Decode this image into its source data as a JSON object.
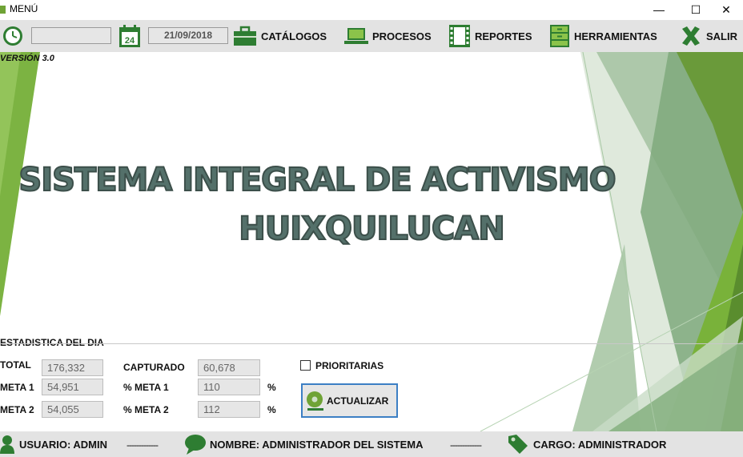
{
  "window": {
    "title": "MENÚ",
    "minimize": "—",
    "maximize": "☐",
    "close": "✕"
  },
  "toolbar": {
    "clock_value": "",
    "date_value": "21/09/2018",
    "calendar_day": "24",
    "catalogos": "CATÁLOGOS",
    "procesos": "PROCESOS",
    "reportes": "REPORTES",
    "herramientas": "HERRAMIENTAS",
    "salir": "SALIR"
  },
  "main": {
    "version": "VERSIÓN 3.0",
    "title_line1": "SISTEMA INTEGRAL DE ACTIVISMO",
    "title_line2": "HUIXQUILUCAN"
  },
  "stats": {
    "heading": "ESTADISTICA DEL DIA",
    "total_label": "TOTAL",
    "total_value": "176,332",
    "meta1_label": "META 1",
    "meta1_value": "54,951",
    "meta2_label": "META 2",
    "meta2_value": "54,055",
    "capturado_label": "CAPTURADO",
    "capturado_value": "60,678",
    "pct_meta1_label": "% META 1",
    "pct_meta1_value": "110",
    "pct_meta2_label": "% META 2",
    "pct_meta2_value": "112",
    "pct_sign": "%",
    "prioritarias_label": "PRIORITARIAS",
    "prioritarias_checked": false,
    "actualizar_label": "ACTUALIZAR"
  },
  "status": {
    "usuario": "USUARIO:  ADMIN",
    "separator": "-------------",
    "nombre": "NOMBRE:  ADMINISTRADOR DEL SISTEMA",
    "cargo": "CARGO:  ADMINISTRADOR"
  },
  "colors": {
    "accent_green": "#6fa336",
    "dark_green": "#2e7d32",
    "toolbar_bg": "#e3e3e3",
    "title_text": "#54706a",
    "button_border": "#3c7fc4"
  }
}
